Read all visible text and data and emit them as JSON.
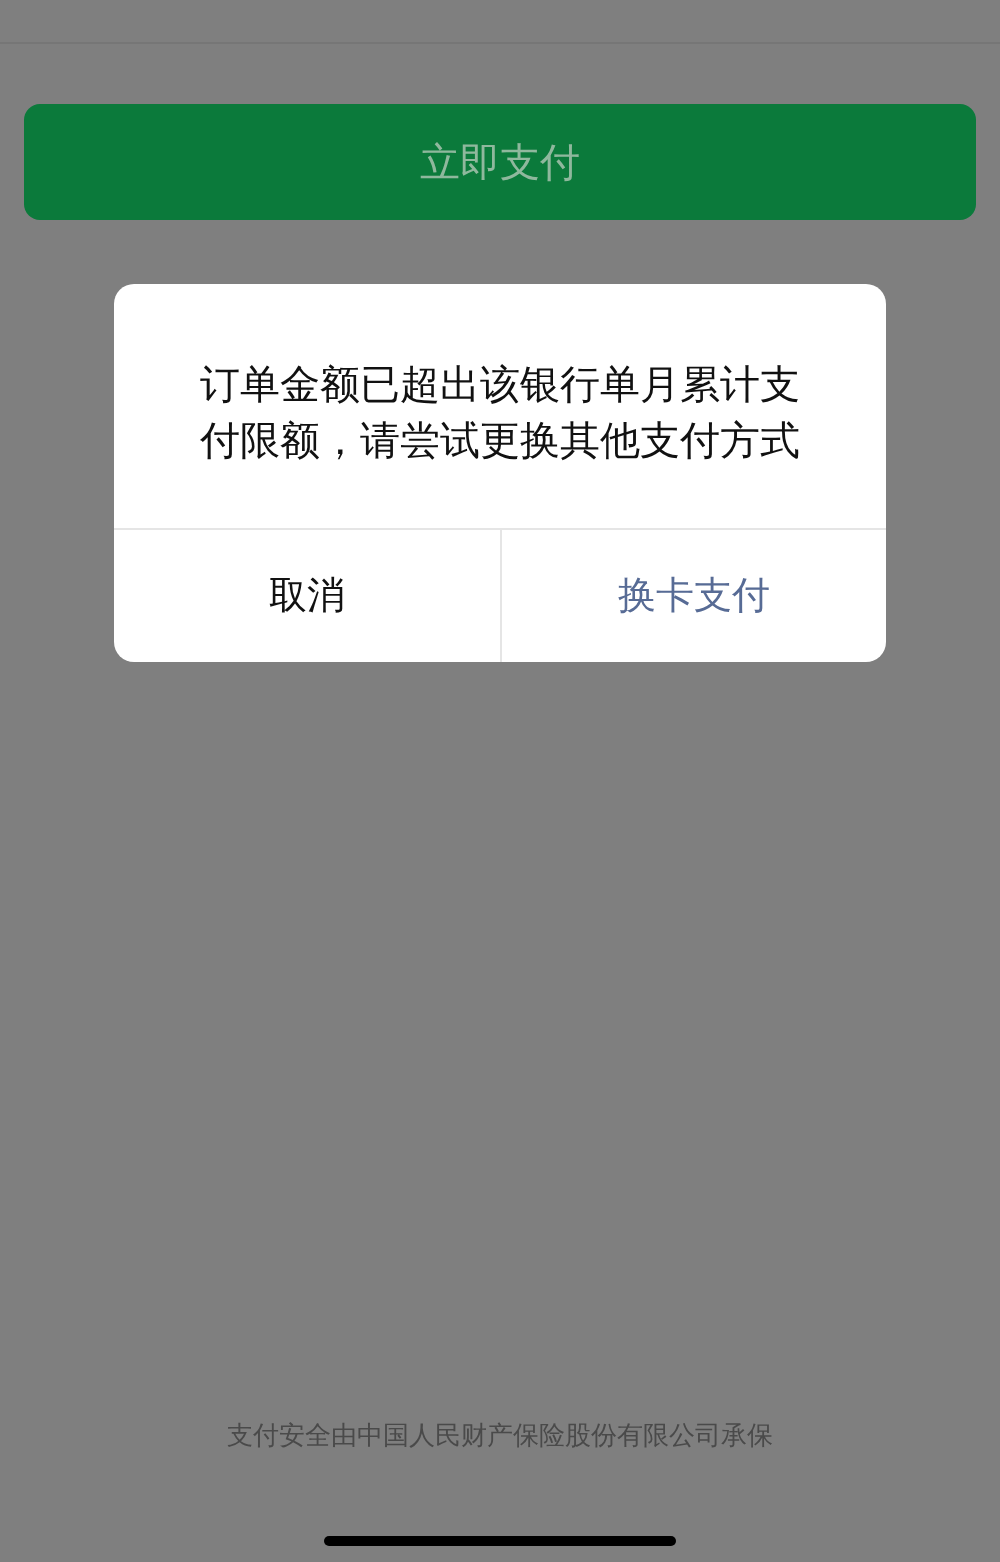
{
  "pay_button": {
    "label": "立即支付"
  },
  "dialog": {
    "message": "订单金额已超出该银行单月累计支付限额，请尝试更换其他支付方式",
    "buttons": [
      {
        "label": "取消",
        "kind": "cancel"
      },
      {
        "label": "换卡支付",
        "kind": "primary"
      }
    ]
  },
  "footer": "支付安全由中国人民财产保险股份有限公司承保"
}
